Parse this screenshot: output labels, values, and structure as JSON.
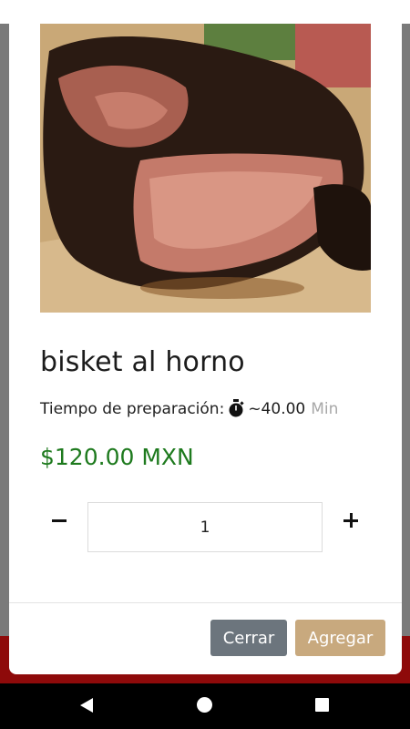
{
  "product": {
    "image_alt": "brisket",
    "name": "bisket al horno",
    "prep_label": "Tiempo de preparación:",
    "prep_time": "~40.00",
    "prep_unit": "Min",
    "price": "$120.00 MXN"
  },
  "quantity": {
    "value": "1"
  },
  "footer": {
    "close_label": "Cerrar",
    "add_label": "Agregar"
  },
  "colors": {
    "price": "#1e7a1e",
    "close_button": "#6c757d",
    "add_button": "#c8a97e",
    "backdrop_bottom": "#8e0a0a"
  },
  "icons": {
    "prep": "stopwatch-icon",
    "decrease": "minus-icon",
    "increase": "plus-icon",
    "nav": [
      "back-icon",
      "home-icon",
      "recents-icon"
    ]
  }
}
